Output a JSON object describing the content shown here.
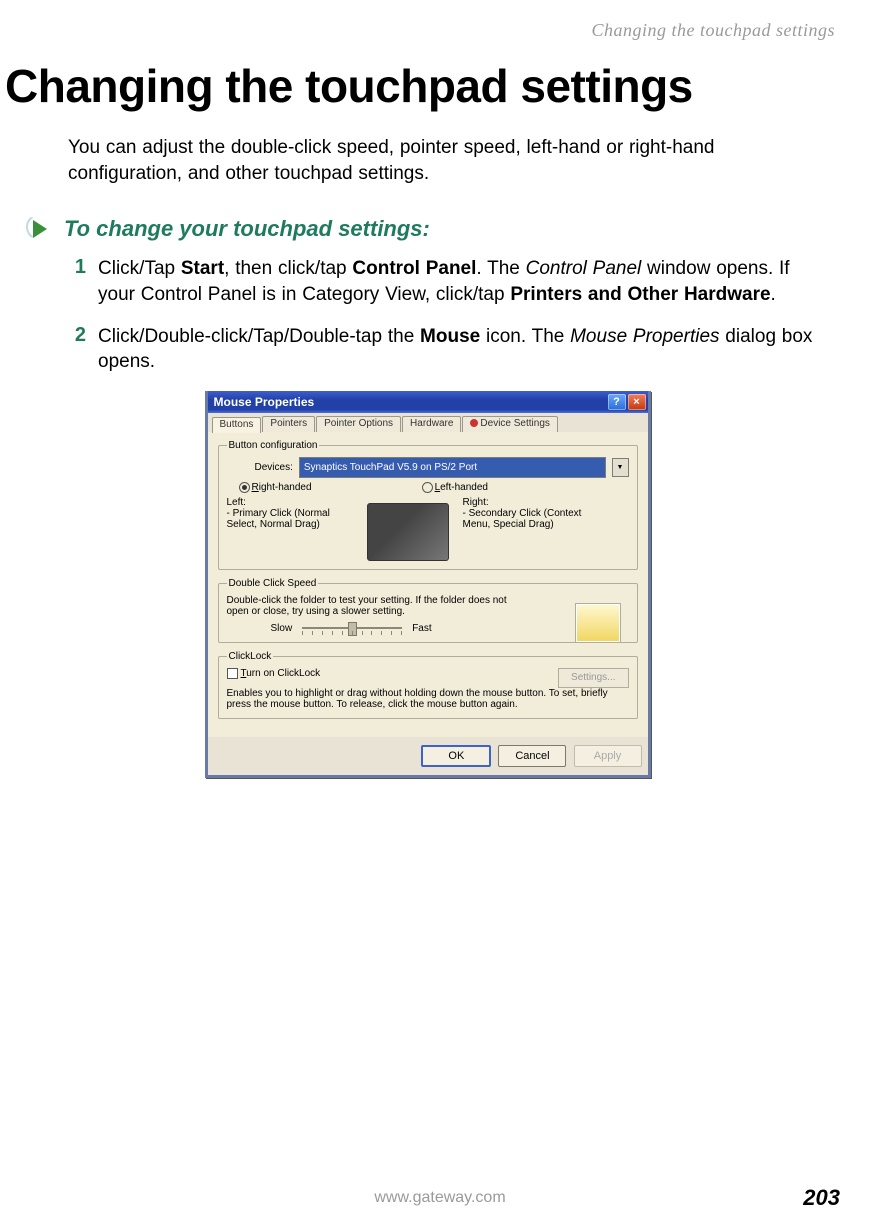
{
  "header": {
    "running_title": "Changing the touchpad settings"
  },
  "title": "Changing the touchpad settings",
  "intro": "You can adjust the double-click speed, pointer speed, left-hand or right-hand configuration, and other touchpad settings.",
  "task": {
    "heading": "To change your touchpad settings:",
    "steps": [
      {
        "num": "1",
        "t1": "Click/Tap ",
        "b1": "Start",
        "t2": ", then click/tap ",
        "b2": "Control Panel",
        "t3": ". The ",
        "i1": "Control Panel",
        "t4": " window opens. If your Control Panel is in Category View, click/tap ",
        "b3": "Printers and Other Hardware",
        "t5": "."
      },
      {
        "num": "2",
        "t1": "Click/Double-click/Tap/Double-tap the ",
        "b1": "Mouse",
        "t2": " icon. The ",
        "i1": "Mouse Properties",
        "t3": " dialog box opens."
      }
    ]
  },
  "dialog": {
    "title": "Mouse Properties",
    "help_glyph": "?",
    "close_glyph": "×",
    "tabs": [
      "Buttons",
      "Pointers",
      "Pointer Options",
      "Hardware",
      "Device Settings"
    ],
    "buttoncfg": {
      "legend": "Button configuration",
      "devices_label": "Devices:",
      "device_selected": "Synaptics TouchPad V5.9 on PS/2 Port",
      "right_handed_u": "R",
      "right_handed_rest": "ight-handed",
      "left_handed_u": "L",
      "left_handed_rest": "eft-handed",
      "left_col_head": "Left:",
      "left_col_body": "- Primary Click (Normal Select, Normal Drag)",
      "right_col_head": "Right:",
      "right_col_body": "- Secondary Click (Context Menu, Special Drag)"
    },
    "doubleclick": {
      "legend": "Double Click Speed",
      "text": "Double-click the folder to test your setting. If the folder does not open or close, try using a slower setting.",
      "slow": "Slow",
      "fast": "Fast"
    },
    "clicklock": {
      "legend": "ClickLock",
      "turn_on_u": "T",
      "turn_on_rest": "urn on ClickLock",
      "settings_btn": "Settings...",
      "desc": "Enables you to highlight or drag without holding down the mouse button. To set, briefly press the mouse button. To release, click the mouse button again."
    },
    "buttons": {
      "ok": "OK",
      "cancel": "Cancel",
      "apply": "Apply"
    }
  },
  "footer": {
    "url": "www.gateway.com",
    "page": "203"
  }
}
